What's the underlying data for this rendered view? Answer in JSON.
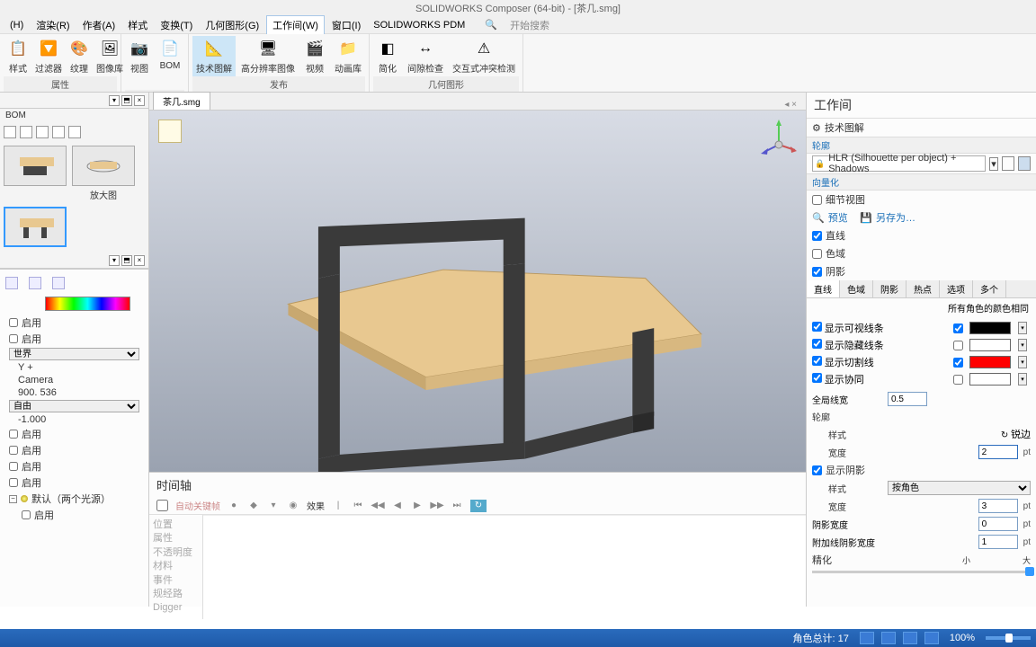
{
  "title": "SOLIDWORKS Composer (64-bit) - [茶几.smg]",
  "menu": {
    "items": [
      "(H)",
      "渲染(R)",
      "作者(A)",
      "样式",
      "变换(T)",
      "几何图形(G)",
      "工作间(W)",
      "窗口(I)",
      "SOLIDWORKS PDM"
    ],
    "activeIndex": 6,
    "search": "开始搜索"
  },
  "ribbon": {
    "groups": [
      {
        "label": "属性",
        "buttons": [
          "样式",
          "过滤器",
          "纹理",
          "图像库"
        ]
      },
      {
        "label": "",
        "buttons": [
          "视图",
          "BOM"
        ]
      },
      {
        "label": "发布",
        "buttons": [
          "技术图解",
          "高分辨率图像",
          "视频",
          "动画库"
        ]
      },
      {
        "label": "几何图形",
        "buttons": [
          "简化",
          "间隙检查",
          "交互式冲突检测"
        ]
      }
    ],
    "activeBtn": "技术图解"
  },
  "leftPanel": {
    "bom": "BOM",
    "thumbs": [
      {
        "label": ""
      },
      {
        "label": "放大图"
      },
      {
        "label": "",
        "selected": true
      }
    ]
  },
  "props": {
    "enable1": "启用",
    "enable2": "启用",
    "world": "世界",
    "yplus": "Y +",
    "camera": "Camera",
    "camVal": "900. 536",
    "free": "自由",
    "freeVal": "-1.000",
    "e1": "启用",
    "e2": "启用",
    "e3": "启用",
    "e4": "启用",
    "light": "默认（两个光源）",
    "lightEnable": "启用"
  },
  "docTab": "茶几.smg",
  "timeline": {
    "title": "时间轴",
    "auto": "自动关键帧",
    "effect": "效果",
    "left": [
      "位置",
      "属性",
      "不透明度",
      "材料",
      "事件",
      "规经路",
      "Digger"
    ]
  },
  "right": {
    "title": "工作间",
    "tech": "技术图解",
    "contour": "轮廓",
    "profileSel": "HLR (Silhouette per object) + Shadows",
    "vector": "向量化",
    "detail": "细节视图",
    "preview": "预览",
    "saveAs": "另存为…",
    "c1": "直线",
    "c2": "色域",
    "c3": "阴影",
    "tabs": [
      "直线",
      "色域",
      "阴影",
      "热点",
      "选项",
      "多个"
    ],
    "sameColor": "所有角色的颜色相同",
    "g1": "显示可视线条",
    "g2": "显示隐藏线条",
    "g3": "显示切割线",
    "g4": "显示协同",
    "globalWidth": "全局线宽",
    "globalWidthVal": "0.5",
    "contour2": "轮廓",
    "style": "样式",
    "styleVal": "锐边",
    "width": "宽度",
    "widthVal": "2",
    "pt": "pt",
    "ssh": "显示阴影",
    "style2": "样式",
    "style2Val": "按角色",
    "width2": "宽度",
    "width2Val": "3",
    "shadowW": "阴影宽度",
    "shadowWVal": "0",
    "attachW": "附加线阴影宽度",
    "attachWVal": "1",
    "refine": "精化",
    "small": "小",
    "large": "大"
  },
  "status": {
    "roleTotal": "角色总计: 17",
    "zoom": "100%"
  }
}
